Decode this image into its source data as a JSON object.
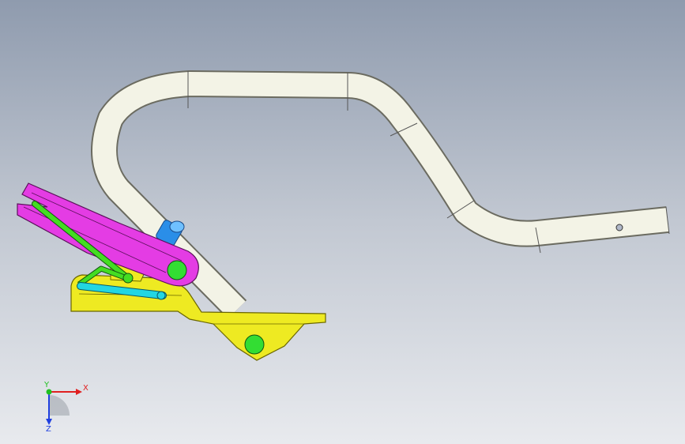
{
  "viewport": {
    "background_top": "#8f9bae",
    "background_bottom": "#e8eaee"
  },
  "model": {
    "parts": [
      {
        "name": "bent-tube-frame",
        "color": "#f3f3e6"
      },
      {
        "name": "pink-lever",
        "color": "#e43ce4"
      },
      {
        "name": "yellow-bracket",
        "color": "#eeea22"
      },
      {
        "name": "green-link",
        "color": "#44dd22"
      },
      {
        "name": "cyan-link",
        "color": "#22d6e2"
      },
      {
        "name": "blue-pin",
        "color": "#2a8ee8"
      }
    ]
  },
  "triad": {
    "x_label": "X",
    "y_label": "Y",
    "z_label": "Z",
    "x_color": "#e02020",
    "y_color": "#20c020",
    "z_color": "#2040e0"
  }
}
